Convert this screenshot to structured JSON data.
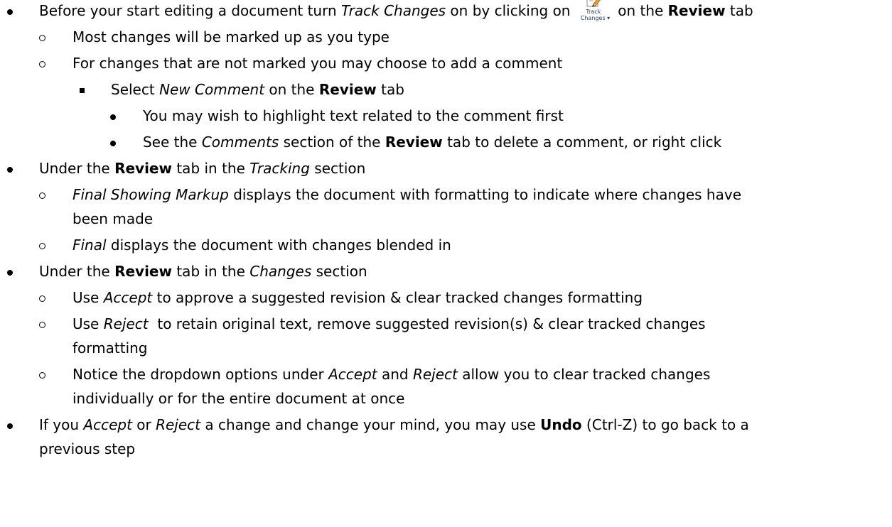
{
  "lines": {
    "l1": {
      "a": "Before your start editing a document turn ",
      "b": "Track Changes",
      "c": " on by clicking on ",
      "d": " on the ",
      "e": "Review",
      "f": " tab"
    },
    "l2": {
      "a": "Most changes will be marked up as you type"
    },
    "l3": {
      "a": "For changes that are not marked you may choose to add a comment"
    },
    "l4": {
      "a": "Select ",
      "b": "New Comment",
      "c": " on the ",
      "d": "Review",
      "e": " tab"
    },
    "l5": {
      "a": "You may wish to highlight text related to the comment first"
    },
    "l6": {
      "a": "See the ",
      "b": "Comments",
      "c": " section of the ",
      "d": "Review",
      "e": " tab to delete a comment, or right click"
    },
    "l7": {
      "a": "Under the ",
      "b": "Review",
      "c": " tab in the ",
      "d": "Tracking",
      "e": " section"
    },
    "l8": {
      "a": "Final Showing Markup",
      "b": " displays the document with formatting to indicate where changes have"
    },
    "l9": {
      "a": "been made"
    },
    "l10": {
      "a": "Final",
      "b": " displays the document with changes blended in"
    },
    "l11": {
      "a": "Under the ",
      "b": "Review",
      "c": " tab in the ",
      "d": "Changes",
      "e": " section"
    },
    "l12": {
      "a": "Use ",
      "b": "Accept",
      "c": " to approve a suggested revision & clear tracked changes formatting"
    },
    "l13": {
      "a": "Use ",
      "b": "Reject",
      "c": "  to retain original text, remove suggested revision(s) & clear tracked changes"
    },
    "l14": {
      "a": "formatting"
    },
    "l15": {
      "a": "Notice the dropdown options under ",
      "b": "Accept",
      "c": " and ",
      "d": "Reject",
      "e": " allow you to clear tracked changes"
    },
    "l16": {
      "a": "individually or for the entire document at once"
    },
    "l17": {
      "a": "If you ",
      "b": "Accept",
      "c": " or ",
      "d": "Reject",
      "e": " a change and change your mind, you may use ",
      "f": "Undo",
      "g": " (Ctrl-Z) to go back to a"
    },
    "l18": {
      "a": "previous step"
    }
  },
  "track_changes_icon": {
    "icon": "track-changes-icon",
    "label_line1": "Track",
    "label_line2": "Changes ▾"
  }
}
